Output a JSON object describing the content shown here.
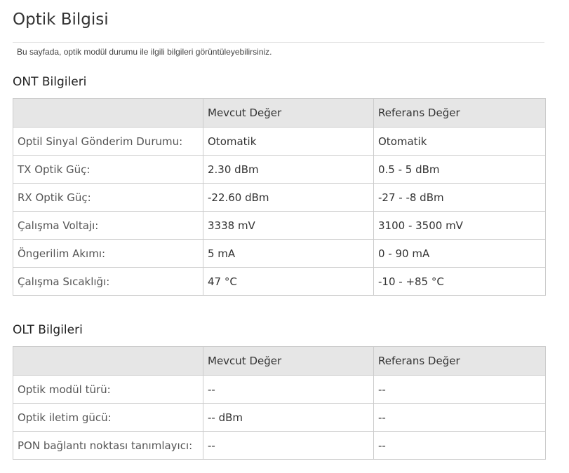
{
  "page": {
    "title": "Optik Bilgisi",
    "description": "Bu sayfada, optik modül durumu ile ilgili bilgileri görüntüleyebilirsiniz."
  },
  "ont": {
    "title": "ONT Bilgileri",
    "headers": [
      "",
      "Mevcut Değer",
      "Referans Değer"
    ],
    "rows": [
      {
        "label": "Optil Sinyal Gönderim Durumu:",
        "current": "Otomatik",
        "reference": "Otomatik"
      },
      {
        "label": "TX Optik Güç:",
        "current": "2.30 dBm",
        "reference": "0.5 - 5 dBm"
      },
      {
        "label": "RX Optik Güç:",
        "current": "-22.60 dBm",
        "reference": "-27 - -8 dBm"
      },
      {
        "label": "Çalışma Voltajı:",
        "current": "3338 mV",
        "reference": "3100 - 3500 mV"
      },
      {
        "label": "Öngerilim Akımı:",
        "current": "5 mA",
        "reference": "0 - 90 mA"
      },
      {
        "label": "Çalışma Sıcaklığı:",
        "current": "47 °C",
        "reference": "-10 - +85 °C"
      }
    ]
  },
  "olt": {
    "title": "OLT Bilgileri",
    "headers": [
      "",
      "Mevcut Değer",
      "Referans Değer"
    ],
    "rows": [
      {
        "label": "Optik modül türü:",
        "current": "--",
        "reference": "--"
      },
      {
        "label": "Optik iletim gücü:",
        "current": "-- dBm",
        "reference": "--"
      },
      {
        "label": "PON bağlantı noktası tanımlayıcı:",
        "current": "--",
        "reference": "--"
      }
    ]
  }
}
